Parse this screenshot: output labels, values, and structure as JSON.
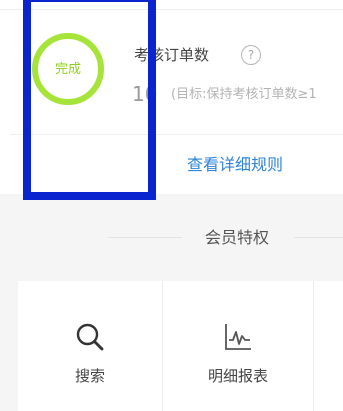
{
  "metric": {
    "status": "完成",
    "title": "考核订单数",
    "help_glyph": "?",
    "value": "10",
    "target": "(目标:保持考核订单数≥1"
  },
  "rules_link": "查看详细规则",
  "section": {
    "title": "会员特权"
  },
  "privileges": [
    {
      "label": "搜索",
      "icon": "search-icon"
    },
    {
      "label": "明细报表",
      "icon": "line-chart-icon"
    }
  ],
  "colors": {
    "ring": "#a6e43a",
    "link": "#2f84d8",
    "selection": "#0a24d0"
  }
}
